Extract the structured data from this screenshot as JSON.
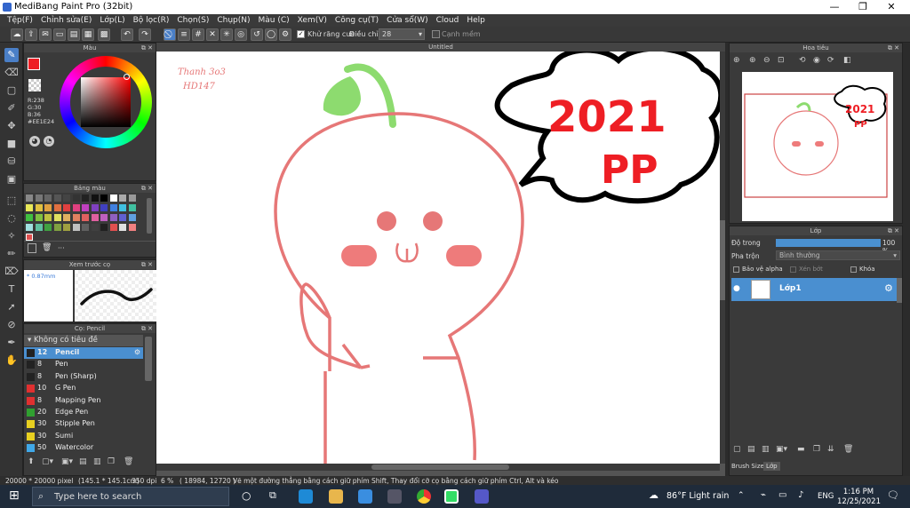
{
  "window": {
    "title": "MediBang Paint Pro (32bit)",
    "minimize": "—",
    "maximize": "❐",
    "close": "✕"
  },
  "menu": [
    "Tệp(F)",
    "Chỉnh sửa(E)",
    "Lớp(L)",
    "Bộ lọc(R)",
    "Chọn(S)",
    "Chụp(N)",
    "Màu (C)",
    "Xem(V)",
    "Công cụ(T)",
    "Cửa sổ(W)",
    "Cloud",
    "Help"
  ],
  "toolbar": {
    "antialias_label": "Khử răng cưa",
    "adjust_label": "Điều chỉnh",
    "adjust_value": "28",
    "edge_label": "Cạnh mềm"
  },
  "color_panel": {
    "title": "Màu",
    "r": "R:238",
    "g": "G:30",
    "b": "B:36",
    "hex": "#EE1E24",
    "primary": "#ee1e24",
    "secondary": "#3346c8"
  },
  "palette_panel": {
    "title": "Bảng màu",
    "more": "···"
  },
  "preview_panel": {
    "title": "Xem trước cọ",
    "size": "0.87mm"
  },
  "brush_panel": {
    "title": "Cọ: Pencil",
    "group": "Không có tiêu đề",
    "items": [
      {
        "size": "12",
        "name": "Pencil",
        "color": "#222222",
        "selected": true
      },
      {
        "size": "8",
        "name": "Pen",
        "color": "#222222"
      },
      {
        "size": "8",
        "name": "Pen (Sharp)",
        "color": "#222222"
      },
      {
        "size": "10",
        "name": "G Pen",
        "color": "#e03030"
      },
      {
        "size": "8",
        "name": "Mapping Pen",
        "color": "#e03030"
      },
      {
        "size": "20",
        "name": "Edge Pen",
        "color": "#30a030"
      },
      {
        "size": "30",
        "name": "Stipple Pen",
        "color": "#e8d020"
      },
      {
        "size": "30",
        "name": "Sumi",
        "color": "#e8d020"
      },
      {
        "size": "50",
        "name": "Watercolor",
        "color": "#40a8e8"
      }
    ]
  },
  "canvas": {
    "title": "Untitled",
    "handwriting_line1": "Thanh 3o3",
    "handwriting_line2": "HD147",
    "bubble_line1": "2021",
    "bubble_line2": "PP"
  },
  "navigator": {
    "title": "Hoa tiêu",
    "bubble_line1": "2021",
    "bubble_line2": "PP"
  },
  "layer_panel": {
    "title": "Lớp",
    "opacity_label": "Độ trong",
    "opacity_value": "100 %",
    "opacity_fraction": 1.0,
    "blend_label": "Pha trộn",
    "blend_value": "Bình thường",
    "protect_alpha": "Bảo vệ alpha",
    "clip": "Xén bớt",
    "lock": "Khóa",
    "layer_name": "Lớp1"
  },
  "right_tabs": {
    "brush_size": "Brush Size",
    "layer": "Lớp"
  },
  "status": {
    "dims": "20000 * 20000 pixel",
    "cm": "(145.1 * 145.1cm)",
    "dpi": "350 dpi",
    "zoom": "6 %",
    "coords": "( 18984, 12720 )",
    "hint": "Vẽ một đường thẳng bằng cách giữ phím Shift, Thay đổi cỡ cọ bằng cách giữ phím Ctrl, Alt và kéo"
  },
  "taskbar": {
    "search": "Type here to search",
    "weather": "86°F  Light rain",
    "lang": "ENG",
    "time": "1:16 PM",
    "date": "12/25/2021"
  }
}
